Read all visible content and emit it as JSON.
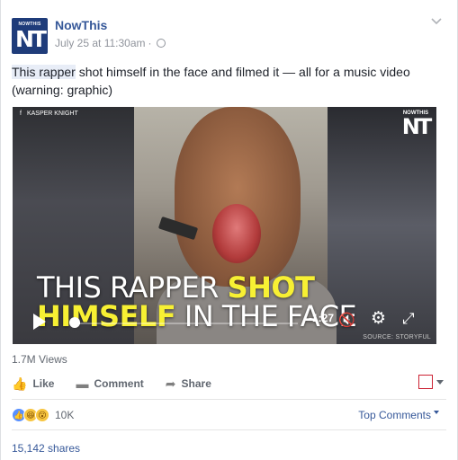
{
  "post": {
    "page_name": "NowThis",
    "timestamp": "July 25 at 11:30am",
    "separator": "·",
    "avatar_small": "NOWTHIS",
    "avatar_big": "NT",
    "text_highlight": "This rapper",
    "text_rest": " shot himself in the face and filmed it — all for a music video (warning: graphic)"
  },
  "video": {
    "credit": "KASPER KNIGHT",
    "credit_icon": "f",
    "logo_small": "NOWTHIS",
    "logo_big": "NT",
    "caption_line1_white": "THIS RAPPER ",
    "caption_line1_yellow": "SHOT",
    "caption_line2_yellow": "HIMSELF",
    "caption_line2_white": " IN THE FACE",
    "time_remaining": "-1:27",
    "mute_glyph": "🔇",
    "source": "SOURCE: STORYFUL",
    "progress": 0.03
  },
  "stats": {
    "views": "1.7M Views",
    "reactions_count": "10K",
    "shares": "15,142 shares"
  },
  "actions": {
    "like": "Like",
    "comment": "Comment",
    "share": "Share"
  },
  "comments": {
    "sort_label": "Top Comments"
  },
  "icons": {
    "like": "👍",
    "comment": "▬",
    "share": "➦",
    "gear": "⚙",
    "fullscreen": "⤢"
  },
  "colors": {
    "link_blue": "#365899",
    "caption_yellow": "#f7f033",
    "brand_navy": "#1f3c7a"
  }
}
